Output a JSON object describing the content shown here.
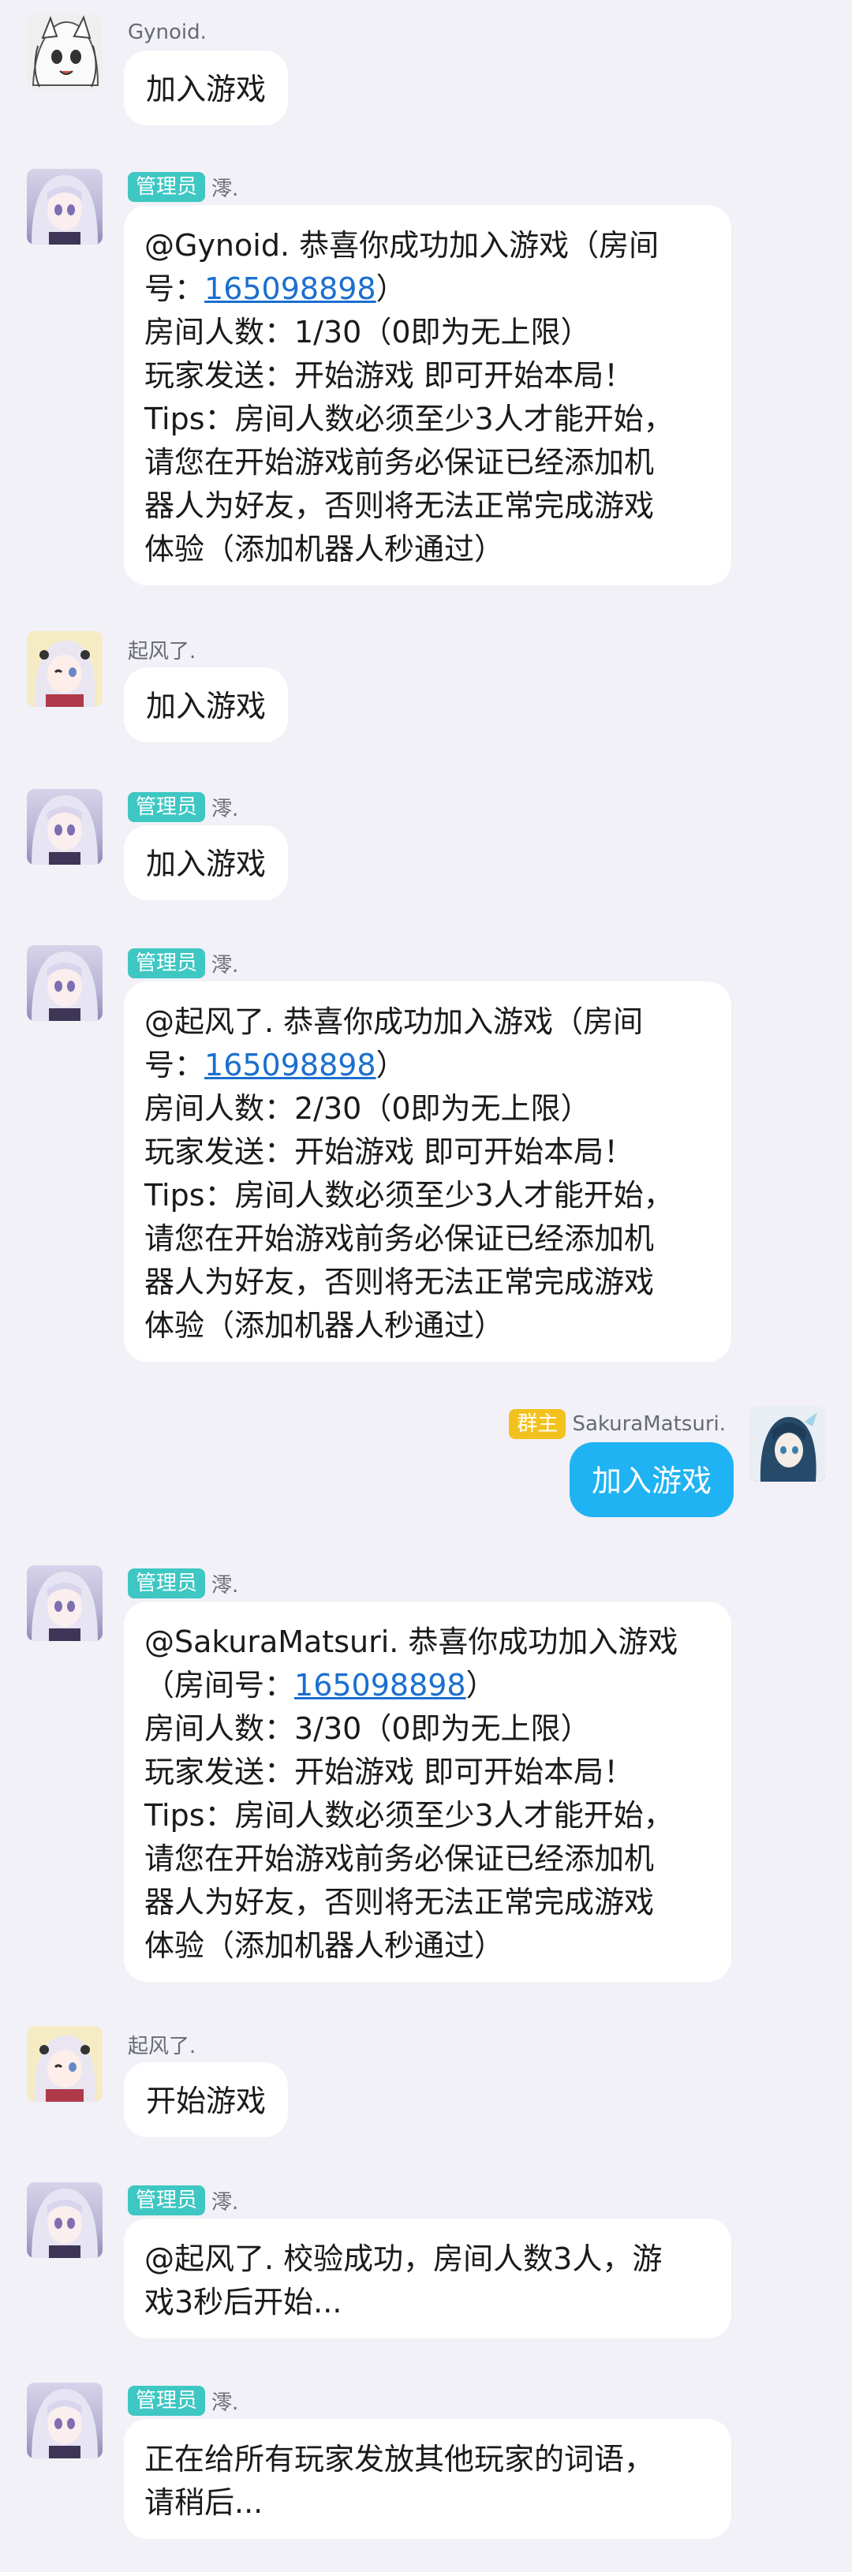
{
  "link_number": "165098898",
  "messages": [
    {
      "sender": "Gynoid.",
      "text": "加入游戏"
    },
    {
      "badge": "管理员",
      "sender": "澪.",
      "line1": "@Gynoid. 恭喜你成功加入游戏（房间",
      "line2_a": "号：",
      "line2_b": "）",
      "rest": "房间人数：1/30（0即为无上限）\n玩家发送：开始游戏 即可开始本局！\nTips：房间人数必须至少3人才能开始，\n请您在开始游戏前务必保证已经添加机\n器人为好友，否则将无法正常完成游戏\n体验（添加机器人秒通过）"
    },
    {
      "sender": "起风了.",
      "text": "加入游戏"
    },
    {
      "badge": "管理员",
      "sender": "澪.",
      "text": "加入游戏"
    },
    {
      "badge": "管理员",
      "sender": "澪.",
      "line1": "@起风了. 恭喜你成功加入游戏（房间",
      "line2_a": "号：",
      "line2_b": "）",
      "rest": "房间人数：2/30（0即为无上限）\n玩家发送：开始游戏 即可开始本局！\nTips：房间人数必须至少3人才能开始，\n请您在开始游戏前务必保证已经添加机\n器人为好友，否则将无法正常完成游戏\n体验（添加机器人秒通过）"
    },
    {
      "badge": "群主",
      "sender": "SakuraMatsuri.",
      "text": "加入游戏"
    },
    {
      "badge": "管理员",
      "sender": "澪.",
      "line1": "@SakuraMatsuri. 恭喜你成功加入游戏",
      "line2_a": "（房间号：",
      "line2_b": "）",
      "rest": "房间人数：3/30（0即为无上限）\n玩家发送：开始游戏 即可开始本局！\nTips：房间人数必须至少3人才能开始，\n请您在开始游戏前务必保证已经添加机\n器人为好友，否则将无法正常完成游戏\n体验（添加机器人秒通过）"
    },
    {
      "sender": "起风了.",
      "text": "开始游戏"
    },
    {
      "badge": "管理员",
      "sender": "澪.",
      "text": "@起风了. 校验成功，房间人数3人，游\n戏3秒后开始..."
    },
    {
      "badge": "管理员",
      "sender": "澪.",
      "text": "正在给所有玩家发放其他玩家的词语，\n请稍后..."
    }
  ]
}
